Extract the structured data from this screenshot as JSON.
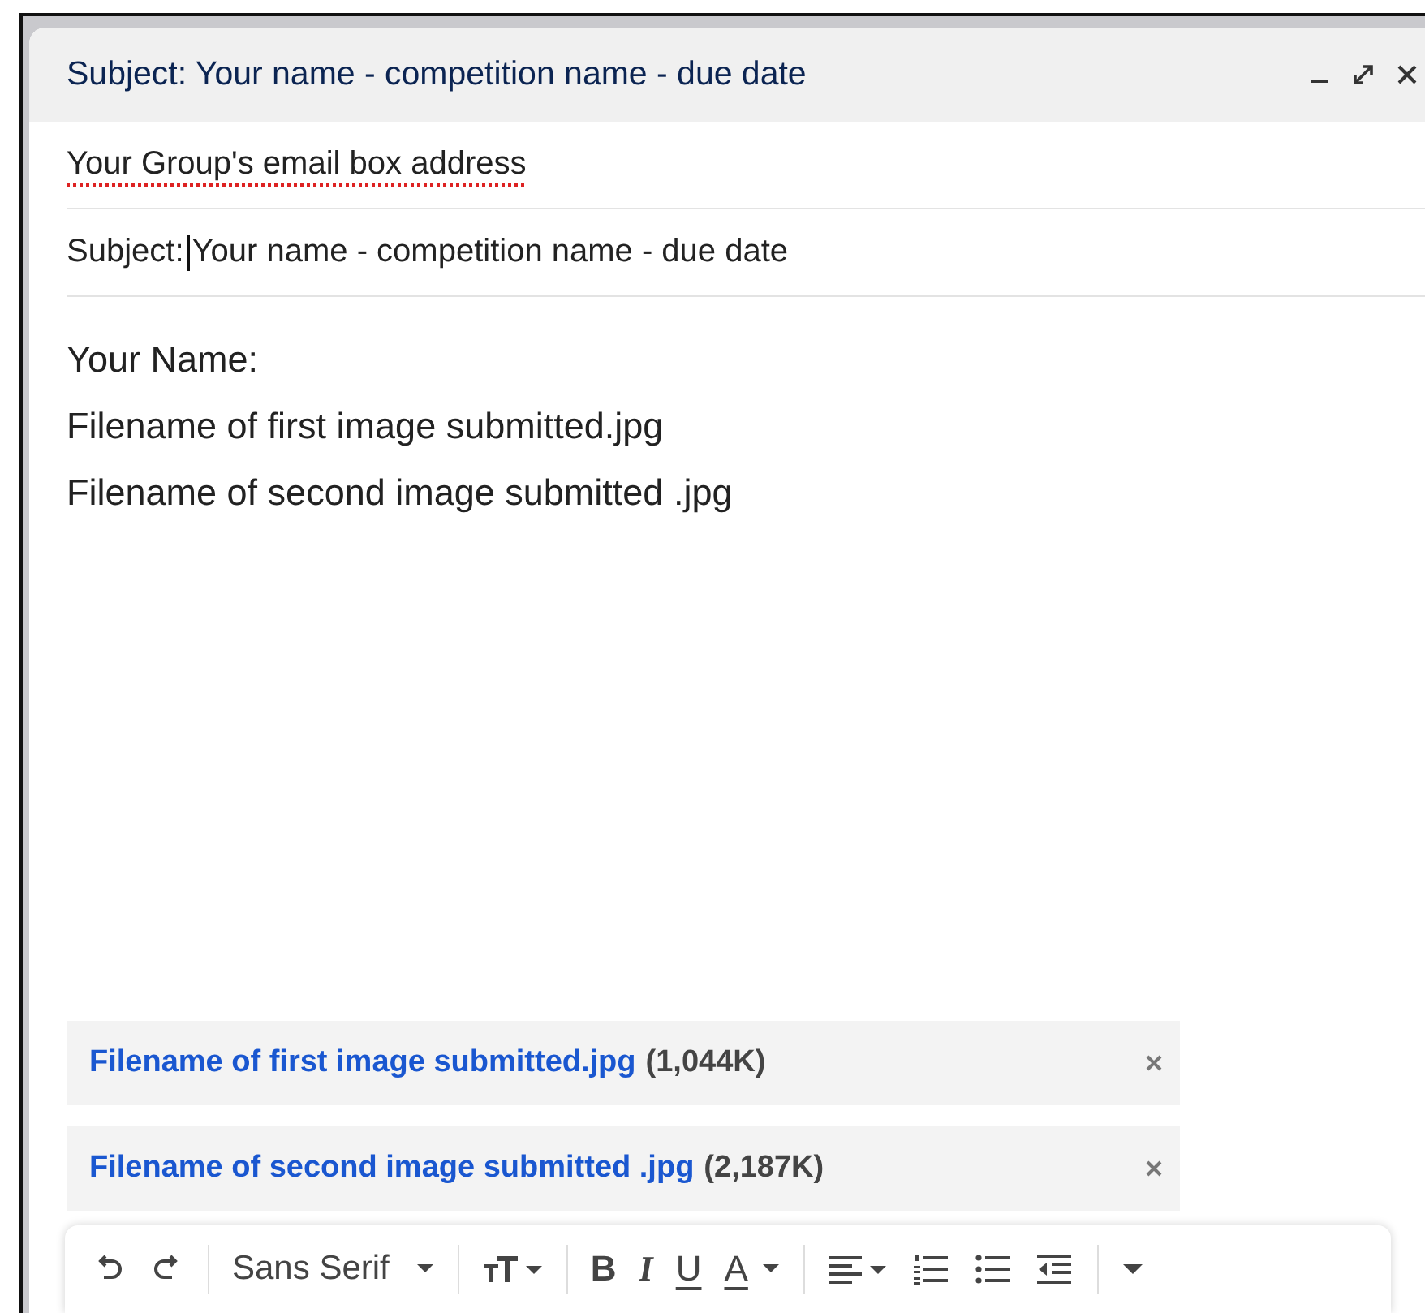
{
  "compose": {
    "title": "Subject: Your name - competition name - due date",
    "to": {
      "value": "Your Group's email box address",
      "misspelled": true
    },
    "subject": {
      "label": "Subject:",
      "value": "Your name - competition name - due date",
      "focused": true
    },
    "body": [
      "Your Name:",
      "Filename of first image submitted.jpg",
      "Filename of second image submitted .jpg"
    ],
    "attachments": [
      {
        "name": "Filename of first image submitted.jpg",
        "size": "(1,044K)"
      },
      {
        "name": "Filename of second image submitted .jpg",
        "size": "(2,187K)"
      }
    ],
    "toolbar": {
      "font": "Sans Serif",
      "bold": "B",
      "italic": "I",
      "underline": "U",
      "text_color": "A"
    }
  }
}
